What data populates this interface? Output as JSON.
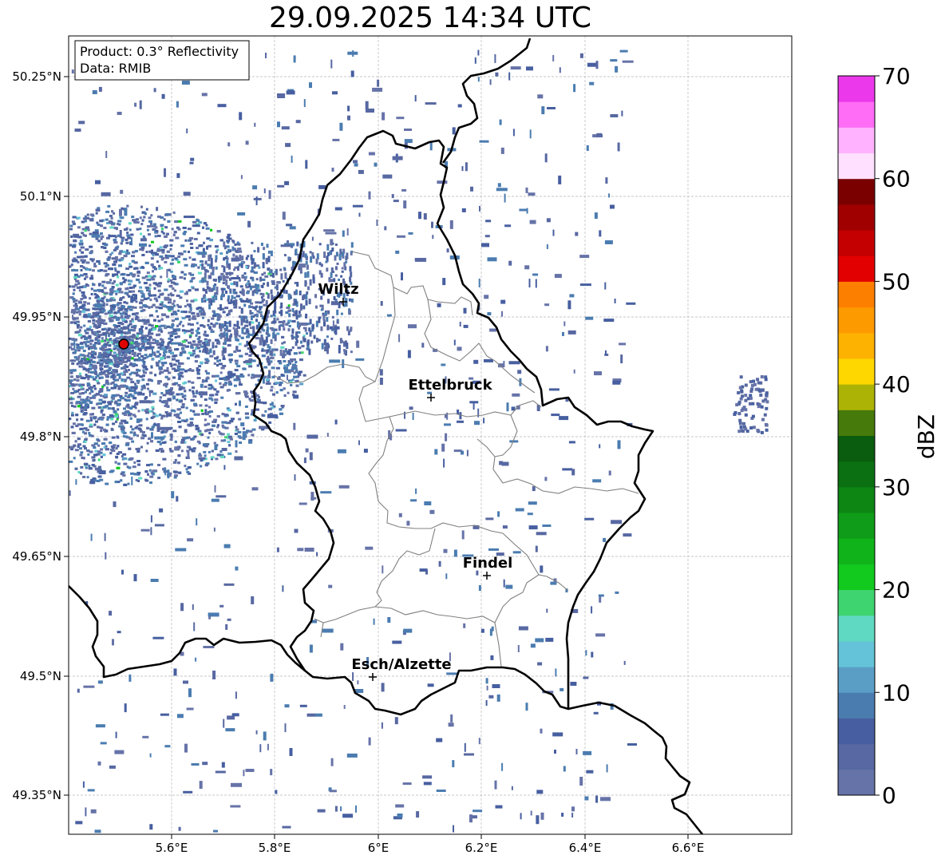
{
  "title": "29.09.2025 14:34 UTC",
  "info_box": {
    "product": "Product: 0.3° Reflectivity",
    "data": "Data: RMIB"
  },
  "map": {
    "lat_ticks": [
      "50.25°N",
      "50.1°N",
      "49.95°N",
      "49.8°N",
      "49.65°N",
      "49.5°N",
      "49.35°N"
    ],
    "lon_ticks": [
      "5.6°E",
      "5.8°E",
      "6°E",
      "6.2°E",
      "6.4°E",
      "6.6°E"
    ],
    "gridlines": true,
    "cities": [
      {
        "name": "Wiltz"
      },
      {
        "name": "Ettelbruck"
      },
      {
        "name": "Findel"
      },
      {
        "name": "Esch/Alzette"
      }
    ],
    "radar_site_marker_color": "#e00000"
  },
  "colorbar": {
    "label": "dBZ",
    "min": 0,
    "max": 70,
    "tick_labels": [
      "0",
      "10",
      "20",
      "30",
      "40",
      "50",
      "60",
      "70"
    ],
    "colors": [
      "#6673a8",
      "#5768a2",
      "#475fa0",
      "#4b7cb0",
      "#5a9ec6",
      "#64c3d8",
      "#60d9c2",
      "#3ed470",
      "#12c91e",
      "#11b31b",
      "#0f9c18",
      "#0d8614",
      "#0b7011",
      "#0a5c0e",
      "#467a0a",
      "#adb305",
      "#ffd700",
      "#fdb100",
      "#fd9a00",
      "#fd7f00",
      "#e30000",
      "#c40000",
      "#a00000",
      "#7a0000",
      "#ffe0ff",
      "#ffb2ff",
      "#ff6cf6",
      "#ea38ea"
    ]
  }
}
